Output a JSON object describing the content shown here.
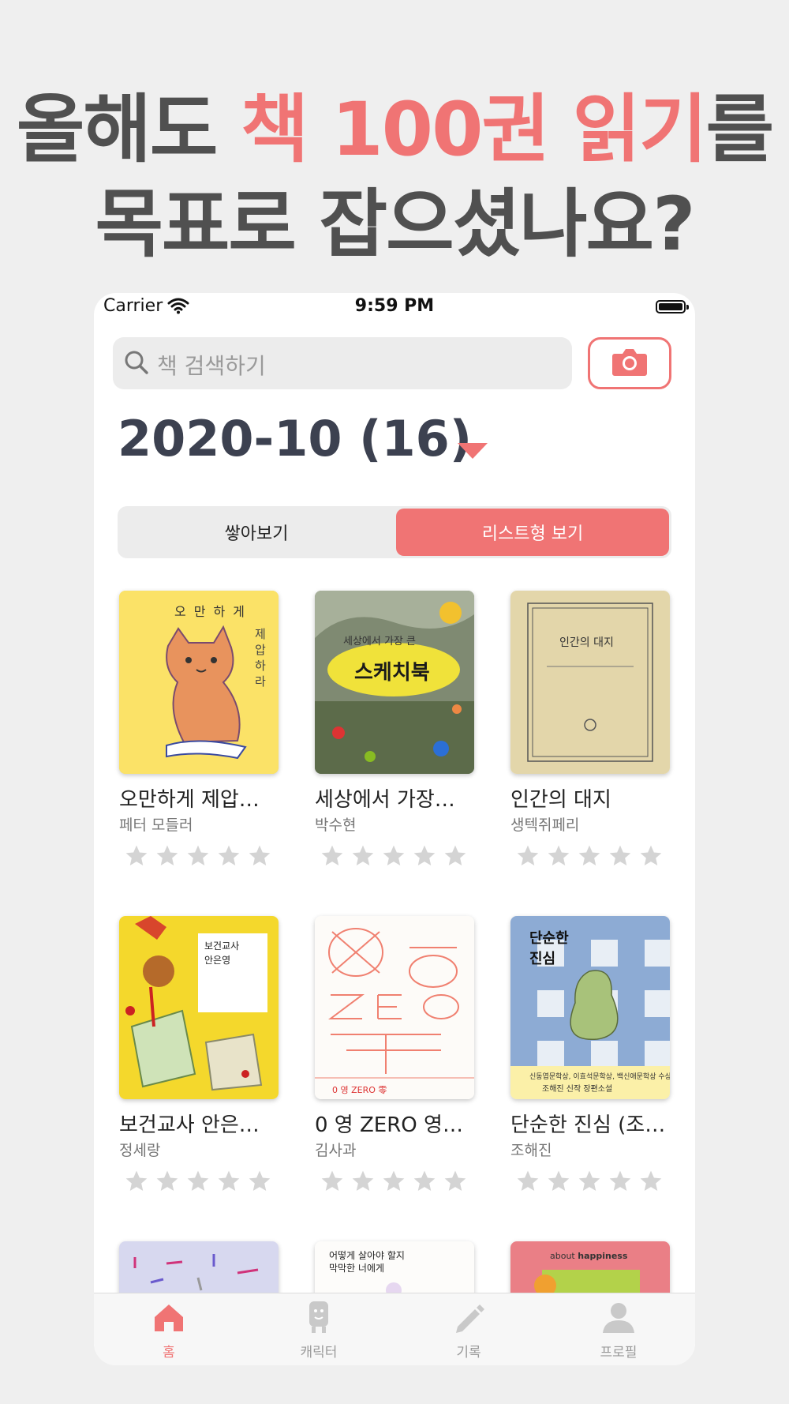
{
  "headline": {
    "line1_pre": "올해도 ",
    "line1_accent": "책 100권 읽기",
    "line1_post": "를",
    "line2": "목표로 잡으셨나요?"
  },
  "status": {
    "carrier": "Carrier",
    "time": "9:59 PM"
  },
  "search": {
    "placeholder": "책 검색하기",
    "icon": "search-icon"
  },
  "camera": {
    "icon": "camera-icon"
  },
  "month": {
    "label": "2020-10 (16)"
  },
  "view_toggle": {
    "stack_label": "쌓아보기",
    "list_label": "리스트형 보기",
    "selected": "list"
  },
  "books": [
    {
      "title": "오만하게 제압…",
      "author": "페터 모들러",
      "rating": 0,
      "cover_text": "오만하게 제압하라"
    },
    {
      "title": "세상에서 가장…",
      "author": "박수현",
      "rating": 0,
      "cover_text": "세상에서 가장 큰 스케치북"
    },
    {
      "title": "인간의 대지",
      "author": "생텍쥐페리",
      "rating": 0,
      "cover_text": "인간의 대지"
    },
    {
      "title": "보건교사 안은…",
      "author": "정세랑",
      "rating": 0,
      "cover_text": "보건교사 안은영"
    },
    {
      "title": "0 영 ZERO 영…",
      "author": "김사과",
      "rating": 0,
      "cover_text": "0 영 ZERO 零"
    },
    {
      "title": "단순한 진심 (조…",
      "author": "조해진",
      "rating": 0,
      "cover_text": "단순한 진심"
    }
  ],
  "partial_covers": [
    {
      "cover_text": ""
    },
    {
      "cover_text": "어떻게 살아야 할지 막막한 너에게"
    },
    {
      "cover_text": "about happiness"
    }
  ],
  "tabs": [
    {
      "label": "홈",
      "icon": "home-icon",
      "active": true
    },
    {
      "label": "캐릭터",
      "icon": "character-icon",
      "active": false
    },
    {
      "label": "기록",
      "icon": "pencil-icon",
      "active": false
    },
    {
      "label": "프로필",
      "icon": "profile-icon",
      "active": false
    }
  ],
  "colors": {
    "accent": "#f07474",
    "headline": "#505050",
    "background": "#efefef"
  }
}
